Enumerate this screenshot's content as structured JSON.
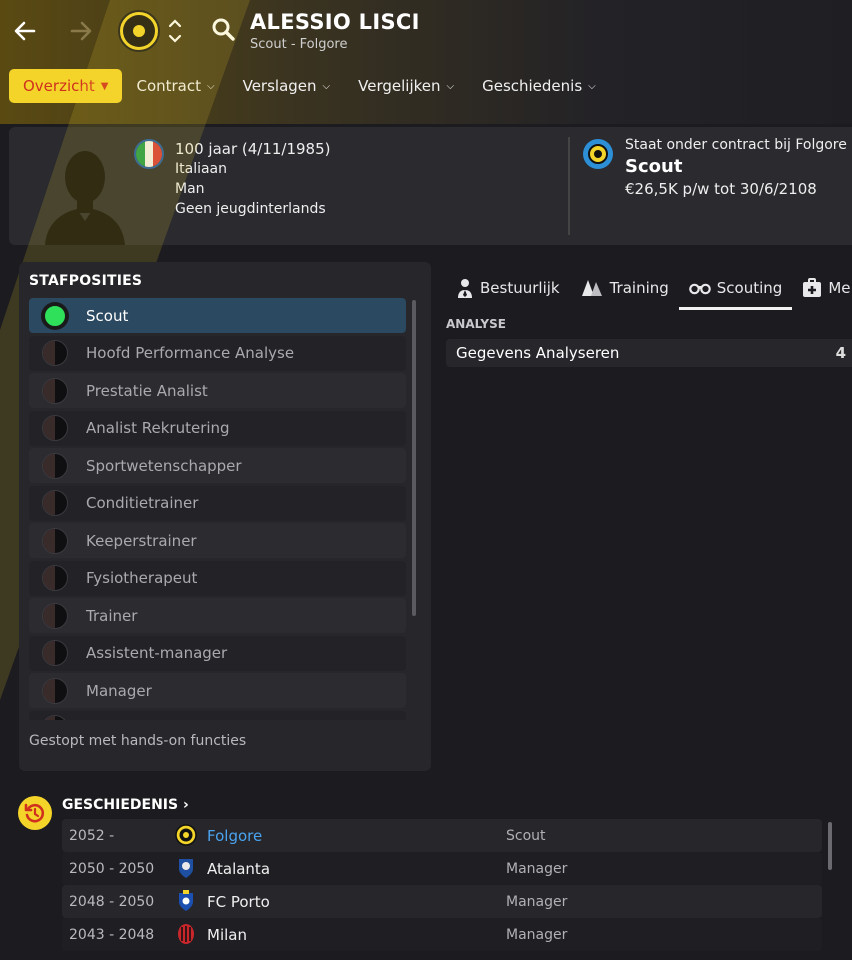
{
  "header": {
    "title": "ALESSIO LISCI",
    "subtitle": "Scout - Folgore"
  },
  "tabs": [
    {
      "label": "Overzicht",
      "active": true
    },
    {
      "label": "Contract"
    },
    {
      "label": "Verslagen"
    },
    {
      "label": "Vergelijken"
    },
    {
      "label": "Geschiedenis"
    }
  ],
  "profile": {
    "age_line": "100 jaar (4/11/1985)",
    "nationality": "Italiaan",
    "gender": "Man",
    "youth_caps": "Geen jeugdinterlands"
  },
  "contract": {
    "line1": "Staat onder contract bij Folgore",
    "role": "Scout",
    "wage": "€26,5K p/w tot 30/6/2108"
  },
  "staff": {
    "title": "STAFPOSITIES",
    "items": [
      "Scout",
      "Hoofd Performance Analyse",
      "Prestatie Analist",
      "Analist Rekrutering",
      "Sportwetenschapper",
      "Conditietrainer",
      "Keeperstrainer",
      "Fysiotherapeut",
      "Trainer",
      "Assistent-manager",
      "Manager"
    ],
    "footer": "Gestopt met hands-on functies"
  },
  "attr_tabs": [
    {
      "label": "Bestuurlijk"
    },
    {
      "label": "Training"
    },
    {
      "label": "Scouting",
      "active": true
    },
    {
      "label": "Me"
    }
  ],
  "analysis": {
    "section": "ANALYSE",
    "row_label": "Gegevens Analyseren",
    "row_value": "4"
  },
  "history": {
    "title": "GESCHIEDENIS",
    "rows": [
      {
        "years": "2052 -",
        "club": "Folgore",
        "role": "Scout"
      },
      {
        "years": "2050 - 2050",
        "club": "Atalanta",
        "role": "Manager"
      },
      {
        "years": "2048 - 2050",
        "club": "FC Porto",
        "role": "Manager"
      },
      {
        "years": "2043 - 2048",
        "club": "Milan",
        "role": "Manager"
      }
    ]
  },
  "colors": {
    "accent_yellow": "#f5d42a",
    "selected_row": "#2b4961",
    "link_blue": "#4aa3ef",
    "active_dot": "#2ee05a"
  }
}
